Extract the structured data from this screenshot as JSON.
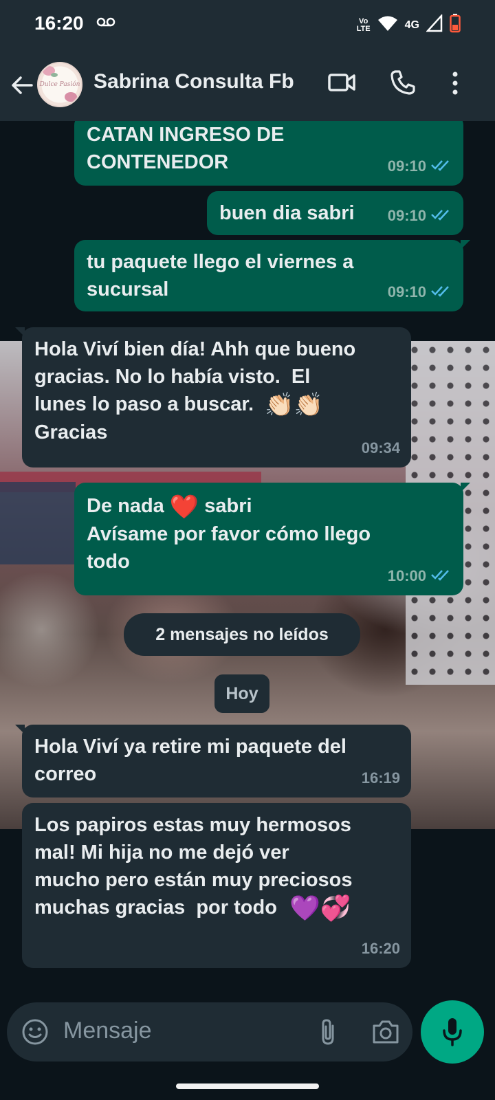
{
  "status_bar": {
    "time": "16:20",
    "lte_label": "Vo LTE",
    "network": "4G",
    "icons": [
      "voicemail-icon",
      "wifi-icon",
      "signal-icon",
      "battery-icon"
    ]
  },
  "header": {
    "contact_name": "Sabrina Consulta Fb",
    "avatar_text": "Dulce Pasión",
    "icons": [
      "back-arrow-icon",
      "video-call-icon",
      "voice-call-icon",
      "more-options-icon"
    ]
  },
  "messages": [
    {
      "dir": "out",
      "text": "CATAN INGRESO DE\nCONTENEDOR",
      "time": "09:10",
      "read": true
    },
    {
      "dir": "out",
      "text": "buen dia sabri",
      "time": "09:10",
      "read": true
    },
    {
      "dir": "out",
      "text": "tu paquete llego el viernes a\nsucursal",
      "time": "09:10",
      "read": true
    },
    {
      "dir": "in",
      "text": "Hola Viví bien día! Ahh que bueno\ngracias. No lo había visto.  El\nlunes lo paso a buscar.",
      "text_after": "Gracias",
      "emoji": "👏🏻👏🏻",
      "time": "09:34"
    },
    {
      "dir": "out",
      "text_before": "De nada",
      "emoji": "❤️",
      "text_after": "sabri\nAvísame por favor cómo llego\ntodo",
      "time": "10:00",
      "read": true
    },
    {
      "dir": "in",
      "text": "Hola Viví ya retire mi paquete del\ncorreo",
      "time": "16:19"
    },
    {
      "dir": "in",
      "text": "Los papiros estas muy hermosos\nmal! Mi hija no me dejó ver\nmucho pero están muy preciosos\nmuchas gracias  por todo",
      "emoji": "💜💞",
      "time": "16:20"
    }
  ],
  "unread_pill": "2 mensajes no leídos",
  "date_pill": "Hoy",
  "composer": {
    "placeholder": "Mensaje",
    "icons": [
      "emoji-icon",
      "attach-icon",
      "camera-icon",
      "mic-icon"
    ]
  },
  "colors": {
    "outgoing_bubble": "#005c4b",
    "incoming_bubble": "#1f2c34",
    "header_bg": "#1f2c34",
    "accent": "#00a884",
    "read_ticks": "#53bdeb"
  }
}
